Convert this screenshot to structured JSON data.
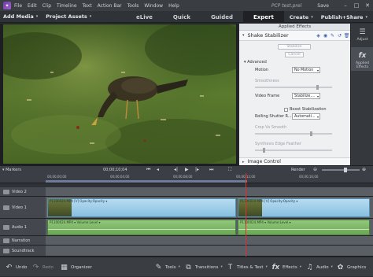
{
  "menubar": {
    "items": [
      "File",
      "Edit",
      "Clip",
      "Timeline",
      "Text",
      "Action Bar",
      "Tools",
      "Window",
      "Help"
    ],
    "filename": "PCP test.prel",
    "save": "Save",
    "win_min": "–",
    "win_max": "□",
    "win_close": "✕"
  },
  "toolbar": {
    "add_media": "Add Media",
    "project_assets": "Project Assets",
    "modes": [
      "eLive",
      "Quick",
      "Guided",
      "Expert"
    ],
    "active_mode": "Expert",
    "create": "Create",
    "publish": "Publish+Share"
  },
  "effects_panel": {
    "title": "Applied Effects",
    "effect_name": "Shake Stabilizer",
    "stabilize_btn": "Stabilize",
    "cancel_btn": "Cancel",
    "advanced": "Advanced",
    "motion_label": "Motion",
    "motion_value": "No Motion",
    "smoothness_label": "Smoothness",
    "video_frame_label": "Video Frame",
    "video_frame_value": "Stabilize,...",
    "boost_label": "Boost Stabilization",
    "rolling_label": "Rolling Shutter R...",
    "rolling_value": "Automati...",
    "crop_label": "Crop Vs Smooth",
    "edge_label": "Synthesis Edge Feather",
    "image_control": "Image Control"
  },
  "right_strip": {
    "adjust_label": "Adjust",
    "applied_label": "Applied Effects"
  },
  "transport": {
    "markers": "Markers",
    "timecode": "00;00;10;04",
    "render": "Render"
  },
  "timeline": {
    "ruler_labels": [
      "00;00;00;00",
      "00;00;04;00",
      "00;00;08;00",
      "00;00;12;00",
      "00;00;16;00"
    ],
    "tracks": [
      {
        "name": "Video 2"
      },
      {
        "name": "Video 1"
      },
      {
        "name": "Audio 1"
      },
      {
        "name": "Narration"
      },
      {
        "name": "Soundtrack"
      }
    ],
    "clip_v1_a": "P1100024.MP4 [V] Opacity:Opacity ▾",
    "clip_v1_b": "P1100024.MP4 [V]  Opacity:Opacity ▾",
    "clip_a1_a": "P1100024.MP4 ▾  Volume:Level ▾",
    "clip_a1_b": "P1100024.MP4 ▾  Volume:Level ▾"
  },
  "dock": {
    "undo": "Undo",
    "redo": "Redo",
    "organizer": "Organizer",
    "tools": "Tools",
    "transitions": "Transitions",
    "titles": "Titles & Text",
    "effects": "Effects",
    "audio": "Audio",
    "graphics": "Graphics"
  }
}
